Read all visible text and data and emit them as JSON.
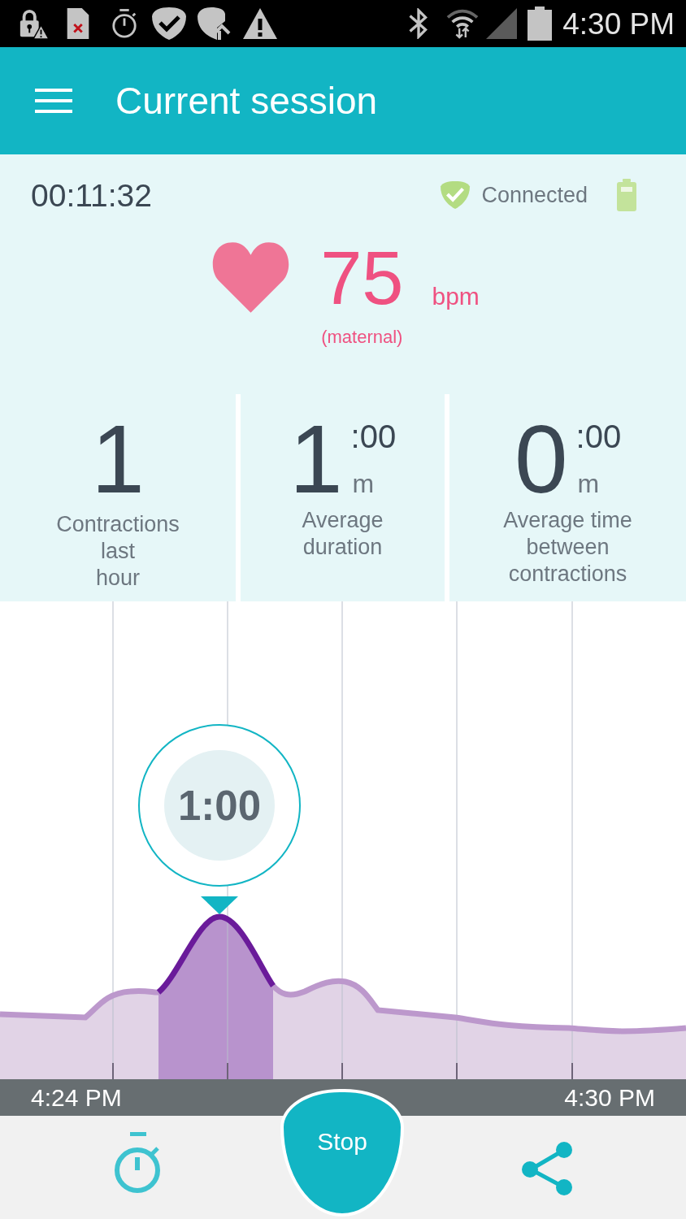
{
  "status_bar": {
    "time": "4:30 PM"
  },
  "app_bar": {
    "title": "Current session"
  },
  "session": {
    "elapsed": "00:11:32",
    "connection": {
      "label": "Connected",
      "connected": true
    },
    "heart_rate": {
      "value": "75",
      "unit": "bpm",
      "note": "(maternal)"
    }
  },
  "stats": [
    {
      "value": "1",
      "label": "Contractions\nlast\nhour"
    },
    {
      "value": "1",
      "seconds": ":00",
      "unit": "m",
      "label": "Average\nduration"
    },
    {
      "value": "0",
      "seconds": ":00",
      "unit": "m",
      "label": "Average time\nbetween\ncontractions"
    }
  ],
  "chart": {
    "callout": "1:00",
    "start_time": "4:24 PM",
    "end_time": "4:30 PM"
  },
  "bottom_bar": {
    "stop_label": "Stop"
  }
}
